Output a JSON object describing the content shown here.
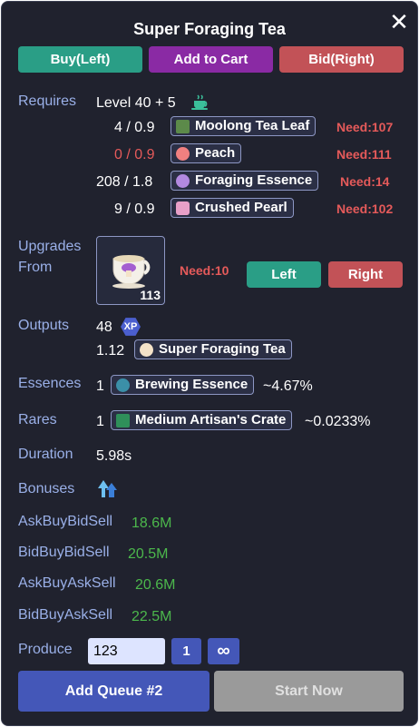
{
  "header": {
    "title": "Super Foraging Tea",
    "close_label": "✕"
  },
  "actions": {
    "buy": "Buy(Left)",
    "cart": "Add to Cart",
    "bid": "Bid(Right)"
  },
  "requires": {
    "label": "Requires",
    "level": "Level 40 + 5",
    "items": [
      {
        "qty": "4 / 0.9",
        "name": "Moolong Tea Leaf",
        "need": "Need:107",
        "short": false
      },
      {
        "qty": "0 / 0.9",
        "name": "Peach",
        "need": "Need:111",
        "short": true
      },
      {
        "qty": "208 / 1.8",
        "name": "Foraging Essence",
        "need": "Need:14",
        "short": false
      },
      {
        "qty": "9 / 0.9",
        "name": "Crushed Pearl",
        "need": "Need:102",
        "short": false
      }
    ]
  },
  "upgrades": {
    "label_line1": "Upgrades",
    "label_line2": "From",
    "count": "113",
    "need": "Need:10",
    "left": "Left",
    "right": "Right"
  },
  "outputs": {
    "label": "Outputs",
    "xp_value": "48",
    "xp_badge": "XP",
    "item_qty": "1.12",
    "item_name": "Super Foraging Tea"
  },
  "essences": {
    "label": "Essences",
    "qty": "1",
    "name": "Brewing Essence",
    "chance": "~4.67%"
  },
  "rares": {
    "label": "Rares",
    "qty": "1",
    "name": "Medium Artisan's Crate",
    "chance": "~0.0233%"
  },
  "duration": {
    "label": "Duration",
    "value": "5.98s"
  },
  "bonuses": {
    "label": "Bonuses"
  },
  "prices": [
    {
      "label": "AskBuyBidSell",
      "value": "18.6M"
    },
    {
      "label": "BidBuyBidSell",
      "value": "20.5M"
    },
    {
      "label": "AskBuyAskSell",
      "value": "20.6M"
    },
    {
      "label": "BidBuyAskSell",
      "value": "22.5M"
    }
  ],
  "produce": {
    "label": "Produce",
    "value": "123",
    "one": "1",
    "infinite": "∞"
  },
  "footer": {
    "queue": "Add Queue #2",
    "start": "Start Now"
  }
}
